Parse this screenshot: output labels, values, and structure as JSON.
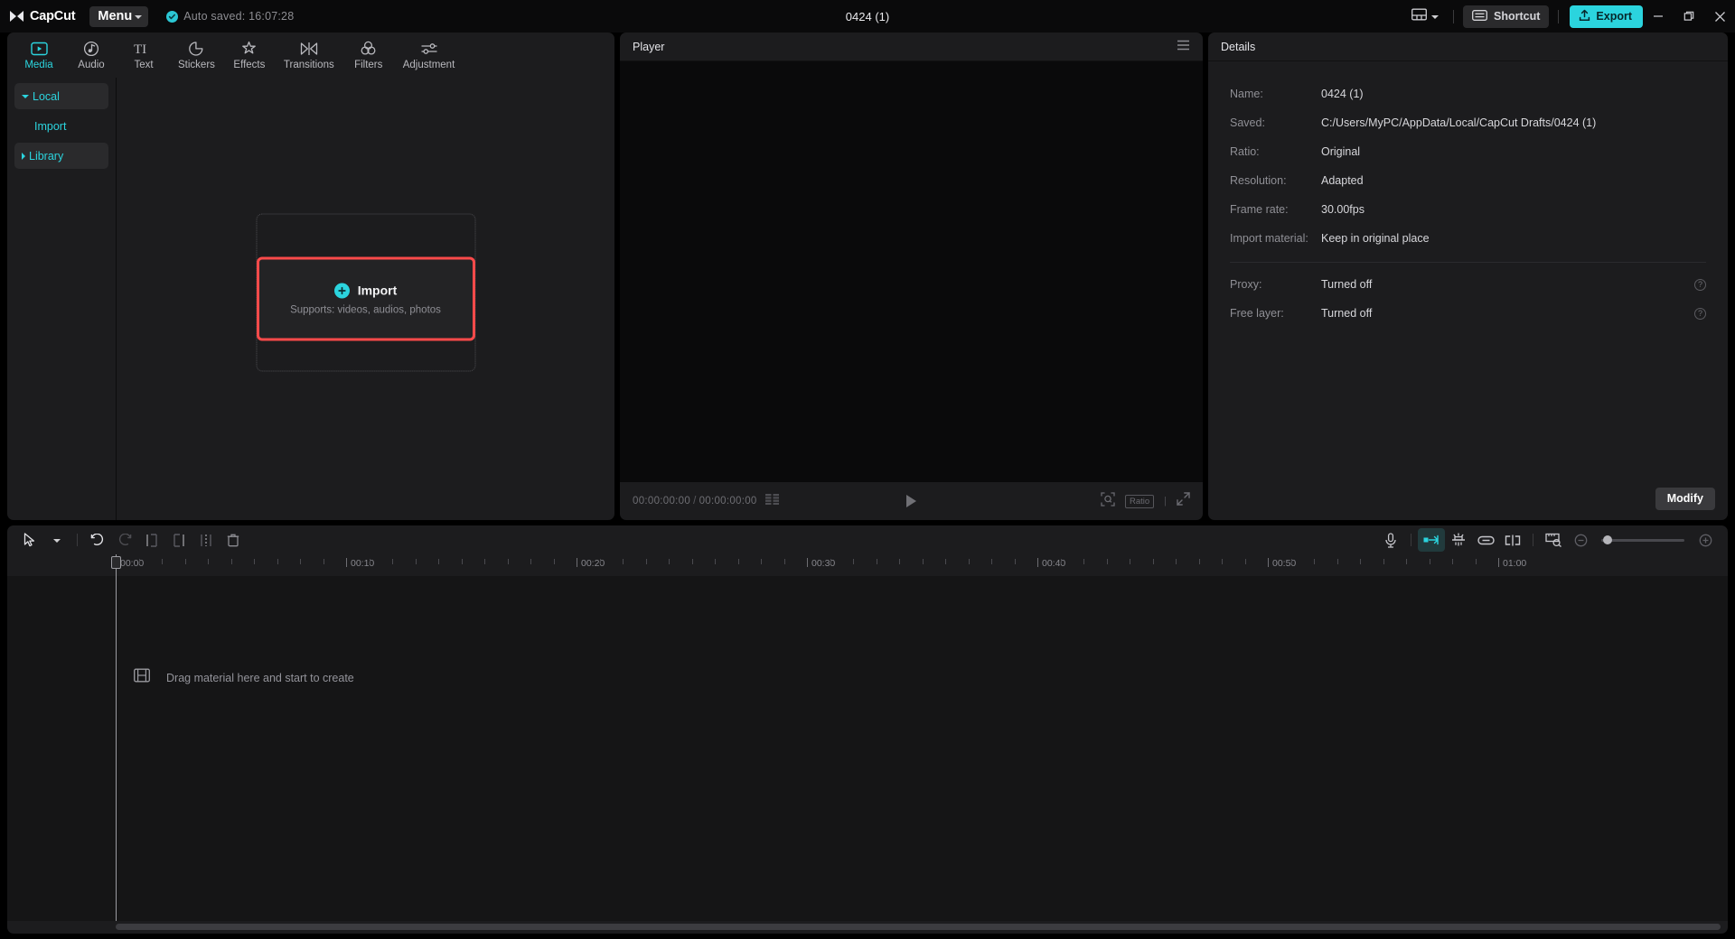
{
  "app": {
    "brand": "CapCut",
    "menu_label": "Menu",
    "autosave_text": "Auto saved: 16:07:28",
    "project_title": "0424 (1)",
    "shortcut_label": "Shortcut",
    "export_label": "Export",
    "accent_color": "#2bd4de",
    "highlight_color": "#fc4a4a"
  },
  "tabs": [
    {
      "label": "Media",
      "icon": "media-icon",
      "active": true
    },
    {
      "label": "Audio",
      "icon": "audio-icon",
      "active": false
    },
    {
      "label": "Text",
      "icon": "text-icon",
      "active": false
    },
    {
      "label": "Stickers",
      "icon": "stickers-icon",
      "active": false
    },
    {
      "label": "Effects",
      "icon": "effects-icon",
      "active": false
    },
    {
      "label": "Transitions",
      "icon": "transitions-icon",
      "active": false
    },
    {
      "label": "Filters",
      "icon": "filters-icon",
      "active": false
    },
    {
      "label": "Adjustment",
      "icon": "adjustment-icon",
      "active": false
    }
  ],
  "sidenav": {
    "local": "Local",
    "import": "Import",
    "library": "Library"
  },
  "media": {
    "import_label": "Import",
    "import_sub": "Supports: videos, audios, photos"
  },
  "player": {
    "title": "Player",
    "current_time": "00:00:00:00",
    "total_time": "00:00:00:00",
    "separator": "/",
    "ratio_label": "Ratio"
  },
  "details": {
    "title": "Details",
    "rows": [
      {
        "key": "Name:",
        "value": "0424 (1)"
      },
      {
        "key": "Saved:",
        "value": "C:/Users/MyPC/AppData/Local/CapCut Drafts/0424 (1)"
      },
      {
        "key": "Ratio:",
        "value": "Original"
      },
      {
        "key": "Resolution:",
        "value": "Adapted"
      },
      {
        "key": "Frame rate:",
        "value": "30.00fps"
      },
      {
        "key": "Import material:",
        "value": "Keep in original place"
      }
    ],
    "toggle_rows": [
      {
        "key": "Proxy:",
        "value": "Turned off",
        "help": "?"
      },
      {
        "key": "Free layer:",
        "value": "Turned off",
        "help": "?"
      }
    ],
    "modify_label": "Modify"
  },
  "timeline": {
    "drag_hint": "Drag material here and start to create",
    "ruler_labels": [
      "00:00",
      "00:10",
      "00:20",
      "00:30",
      "00:40",
      "00:50",
      "01:00"
    ]
  }
}
